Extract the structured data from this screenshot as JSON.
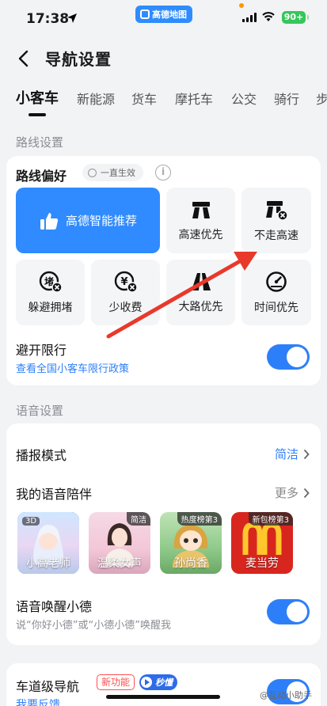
{
  "status_bar": {
    "time": "17:38",
    "app_pill": "高德地图",
    "battery": "90+"
  },
  "header": {
    "title": "导航设置"
  },
  "tabs": [
    "小客车",
    "新能源",
    "货车",
    "摩托车",
    "公交",
    "骑行",
    "步"
  ],
  "route_section": {
    "label": "路线设置",
    "preference_title": "路线偏好",
    "effect_pill": "一直生效",
    "options": {
      "smart": "高德智能推荐",
      "highway_first": "高速优先",
      "avoid_highway": "不走高速",
      "avoid_congestion": "躲避拥堵",
      "less_toll": "少收费",
      "main_road": "大路优先",
      "time_first": "时间优先"
    },
    "avoid_restriction": {
      "title": "避开限行",
      "link": "查看全国小客车限行政策"
    }
  },
  "voice_section": {
    "label": "语音设置",
    "broadcast_mode": {
      "title": "播报模式",
      "value": "简洁"
    },
    "companion": {
      "title": "我的语音陪伴",
      "more": "更多"
    },
    "voices": [
      {
        "name": "小高老师",
        "tag": "3D"
      },
      {
        "name": "温柔女声",
        "tag": "简洁"
      },
      {
        "name": "孙尚香",
        "tag": "热度榜第3"
      },
      {
        "name": "麦当劳",
        "tag": "新包榜第3"
      }
    ],
    "wake": {
      "title": "语音唤醒小德",
      "subtitle": "说“你好小德”或“小德小德”唤醒我"
    }
  },
  "lane_section": {
    "title": "车道级导航",
    "badge_new": "新功能",
    "badge_video": "秒懂",
    "feedback": "我要反馈"
  },
  "watermark": "@互动小助手",
  "colors": {
    "accent": "#2d7ff9",
    "primary_option": "#2f8bff",
    "arrow": "#e8392b"
  }
}
